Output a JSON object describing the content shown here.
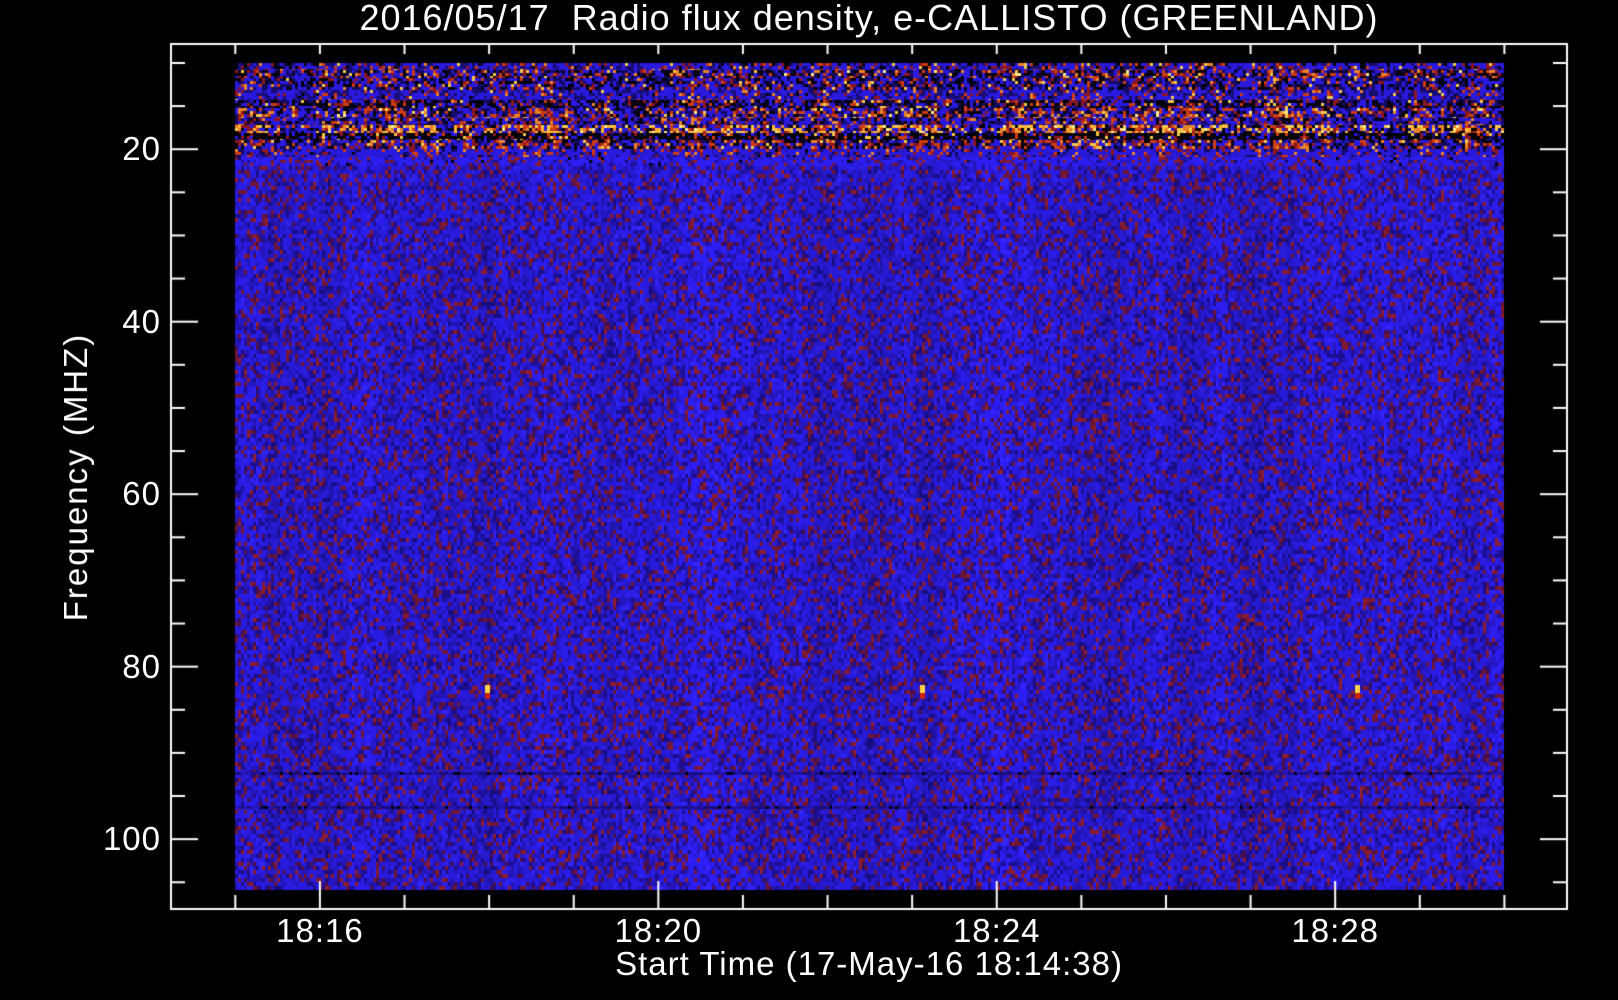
{
  "chart_data": {
    "type": "heatmap",
    "title": "2016/05/17  Radio flux density, e-CALLISTO (GREENLAND)",
    "xlabel": "Start Time (17-May-16 18:14:38)",
    "ylabel": "Frequency (MHZ)",
    "x_tick_labels": [
      "18:16",
      "18:20",
      "18:24",
      "18:28"
    ],
    "x_tick_minutes": [
      16,
      20,
      24,
      28
    ],
    "x_minor_tick_step_min": 1,
    "x_minor_tick_range_min": [
      15,
      30
    ],
    "x_axis_range_min_after_1800": [
      14.24,
      30.74
    ],
    "y_tick_labels": [
      "20",
      "40",
      "60",
      "80",
      "100"
    ],
    "y_tick_mhz": [
      20,
      40,
      60,
      80,
      100
    ],
    "y_minor_tick_step_mhz": 5,
    "y_minor_tick_range_mhz": [
      10,
      105
    ],
    "y_axis_range_mhz": [
      7.8,
      108.1
    ],
    "grid": "off",
    "legend": "none",
    "background_color": "#000000",
    "axis_color": "#ffffff",
    "data_extent": {
      "time_min": [
        15.0,
        30.0
      ],
      "freq_mhz": [
        10.0,
        105.9
      ]
    },
    "rfi_bands": [
      {
        "freq_mhz": [
          10.0,
          10.85
        ],
        "palette": [
          [
            "#2a1ae0",
            0.4
          ],
          [
            "#1a0e7a",
            0.18
          ],
          [
            "#000008",
            0.1
          ],
          [
            "#8c1522",
            0.14,
            1
          ],
          [
            "#cc3b12",
            0.1,
            1
          ],
          [
            "#e8832a",
            0.05,
            1
          ],
          [
            "#f2c84a",
            0.03,
            1
          ]
        ]
      },
      {
        "freq_mhz": [
          10.85,
          11.75
        ],
        "palette": [
          [
            "#0a0410",
            0.26
          ],
          [
            "#2a1ae0",
            0.2
          ],
          [
            "#140a66",
            0.12
          ],
          [
            "#8c1522",
            0.14,
            1
          ],
          [
            "#cc3b12",
            0.14,
            1
          ],
          [
            "#e8832a",
            0.08,
            1
          ],
          [
            "#f2c84a",
            0.04,
            1
          ],
          [
            "#ffe98c",
            0.02,
            1
          ]
        ]
      },
      {
        "freq_mhz": [
          11.75,
          13.1
        ],
        "palette": [
          [
            "#2a1ae0",
            0.3
          ],
          [
            "#140a66",
            0.22
          ],
          [
            "#000008",
            0.16
          ],
          [
            "#8c1522",
            0.14,
            1
          ],
          [
            "#cc3b12",
            0.1,
            1
          ],
          [
            "#e8832a",
            0.05,
            1
          ],
          [
            "#f2c84a",
            0.03,
            1
          ]
        ]
      },
      {
        "freq_mhz": [
          13.1,
          14.35
        ],
        "palette": [
          [
            "#2a1ae0",
            0.48
          ],
          [
            "#1a0e7a",
            0.2
          ],
          [
            "#140a66",
            0.08
          ],
          [
            "#8c1522",
            0.1,
            1
          ],
          [
            "#cc3b12",
            0.08,
            1
          ],
          [
            "#e8832a",
            0.04,
            1
          ],
          [
            "#f2c84a",
            0.02,
            1
          ]
        ]
      },
      {
        "freq_mhz": [
          14.35,
          15.25
        ],
        "palette": [
          [
            "#05020a",
            0.38
          ],
          [
            "#140a66",
            0.14
          ],
          [
            "#2a1ae0",
            0.16
          ],
          [
            "#8c1522",
            0.16,
            1
          ],
          [
            "#cc3b12",
            0.1,
            1
          ],
          [
            "#f2c84a",
            0.04,
            1
          ],
          [
            "#e8832a",
            0.02,
            1
          ]
        ]
      },
      {
        "freq_mhz": [
          15.25,
          16.4
        ],
        "palette": [
          [
            "#cc3b12",
            0.2,
            1
          ],
          [
            "#e8832a",
            0.12,
            1
          ],
          [
            "#f2c84a",
            0.06,
            1
          ],
          [
            "#8c1522",
            0.14,
            1
          ],
          [
            "#2a1ae0",
            0.22
          ],
          [
            "#140a66",
            0.12
          ],
          [
            "#05020a",
            0.12
          ],
          [
            "#ffe98c",
            0.02,
            1
          ]
        ]
      },
      {
        "freq_mhz": [
          16.4,
          17.2
        ],
        "palette": [
          [
            "#2a1ae0",
            0.36
          ],
          [
            "#140a66",
            0.18
          ],
          [
            "#05020a",
            0.14
          ],
          [
            "#8c1522",
            0.14,
            1
          ],
          [
            "#cc3b12",
            0.1,
            1
          ],
          [
            "#e8832a",
            0.08,
            1
          ]
        ]
      },
      {
        "freq_mhz": [
          17.2,
          18.1
        ],
        "palette": [
          [
            "#f2c84a",
            0.16,
            1
          ],
          [
            "#ffb433",
            0.16,
            1
          ],
          [
            "#e8832a",
            0.16,
            1
          ],
          [
            "#cc3b12",
            0.16,
            1
          ],
          [
            "#8c1522",
            0.1,
            1
          ],
          [
            "#ffe98c",
            0.06,
            1
          ],
          [
            "#2a1ae0",
            0.1
          ],
          [
            "#05020a",
            0.1
          ]
        ]
      },
      {
        "freq_mhz": [
          18.1,
          18.95
        ],
        "palette": [
          [
            "#000000",
            0.48
          ],
          [
            "#0a0410",
            0.14
          ],
          [
            "#8c1522",
            0.1,
            1
          ],
          [
            "#cc3b12",
            0.08,
            1
          ],
          [
            "#f2c84a",
            0.06,
            1
          ],
          [
            "#2a1ae0",
            0.1
          ],
          [
            "#140a66",
            0.04
          ]
        ]
      },
      {
        "freq_mhz": [
          18.95,
          19.95
        ],
        "palette": [
          [
            "#cc3b12",
            0.22,
            1
          ],
          [
            "#8c1522",
            0.18,
            1
          ],
          [
            "#e8832a",
            0.1,
            1
          ],
          [
            "#f2c84a",
            0.07,
            1
          ],
          [
            "#05020a",
            0.13
          ],
          [
            "#2a1ae0",
            0.2
          ],
          [
            "#140a66",
            0.1
          ]
        ]
      },
      {
        "freq_mhz": [
          19.95,
          20.9
        ],
        "palette": [
          [
            "#2a1ae0",
            0.46
          ],
          [
            "#2717c4",
            0.16
          ],
          [
            "#140a66",
            0.1
          ],
          [
            "#8c1522",
            0.14,
            1
          ],
          [
            "#cc3b12",
            0.1,
            1
          ],
          [
            "#e8832a",
            0.04,
            1
          ]
        ]
      },
      {
        "freq_mhz": [
          20.9,
          21.9
        ],
        "palette": [
          [
            "#2c1ef2",
            0.55
          ],
          [
            "#2717c4",
            0.18
          ],
          [
            "#1e0f96",
            0.08
          ],
          [
            "#6e1638",
            0.12,
            1
          ],
          [
            "#8c1c2e",
            0.07,
            1
          ]
        ]
      }
    ],
    "body": {
      "freq_mhz": [
        21.9,
        105.9
      ],
      "palette": [
        [
          "#2c1ef2",
          0.4
        ],
        [
          "#2717c4",
          0.22
        ],
        [
          "#1e0f96",
          0.12
        ],
        [
          "#3526ff",
          0.06
        ],
        [
          "#6e1638",
          0.09,
          1
        ],
        [
          "#8c1c2e",
          0.05,
          1
        ],
        [
          "#4a0f4a",
          0.06,
          1
        ]
      ]
    },
    "quiet_rows_mhz": [
      92.2,
      96.2
    ],
    "calibration_dots": {
      "freq_mhz": 83,
      "times_min": [
        17.98,
        23.12,
        28.26
      ],
      "colors": [
        "#ffd24a",
        "#cc2200"
      ]
    }
  }
}
